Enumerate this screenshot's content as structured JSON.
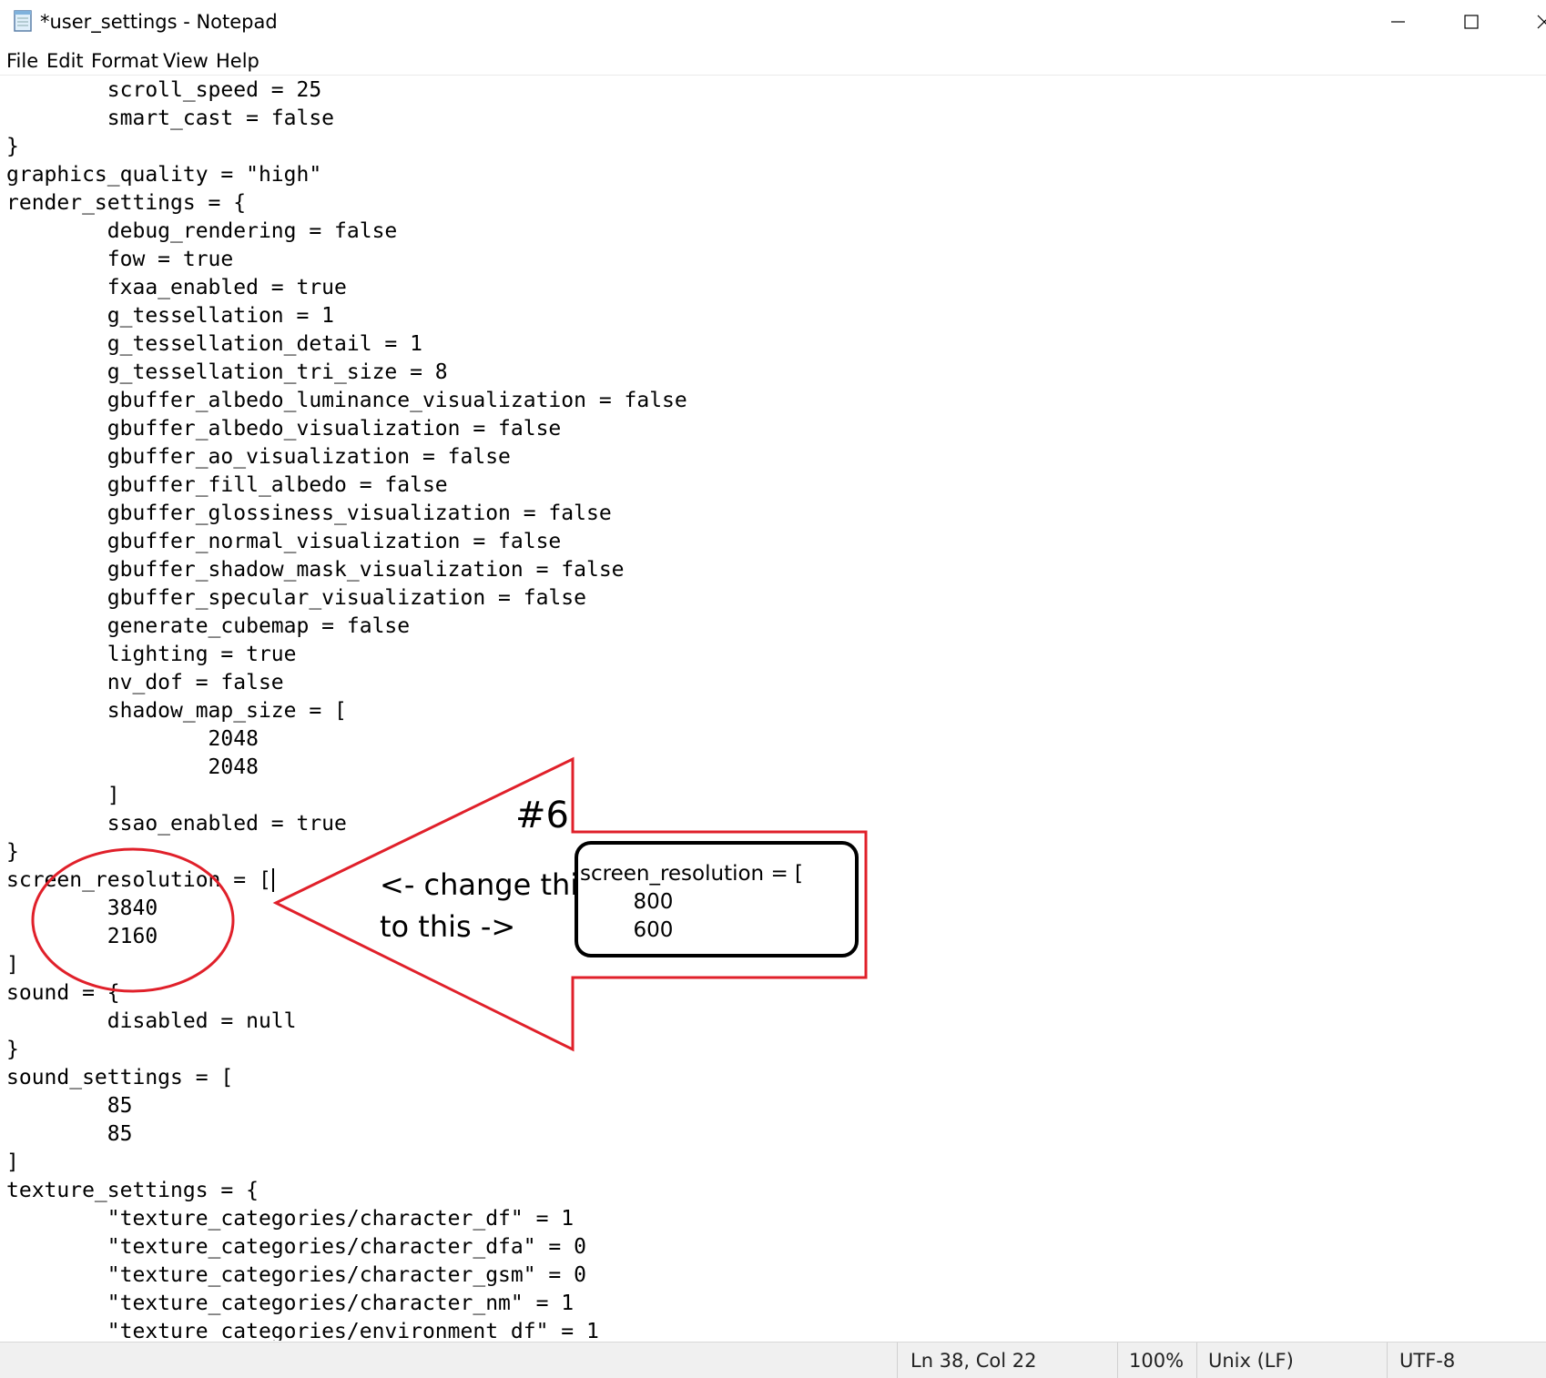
{
  "window": {
    "title": "*user_settings - Notepad",
    "app": "Notepad",
    "icon": "notepad-icon"
  },
  "menu": [
    "File",
    "Edit",
    "Format",
    "View",
    "Help"
  ],
  "editor": {
    "lines": [
      "        scroll_speed = 25",
      "        smart_cast = false",
      "}",
      "graphics_quality = \"high\"",
      "render_settings = {",
      "        debug_rendering = false",
      "        fow = true",
      "        fxaa_enabled = true",
      "        g_tessellation = 1",
      "        g_tessellation_detail = 1",
      "        g_tessellation_tri_size = 8",
      "        gbuffer_albedo_luminance_visualization = false",
      "        gbuffer_albedo_visualization = false",
      "        gbuffer_ao_visualization = false",
      "        gbuffer_fill_albedo = false",
      "        gbuffer_glossiness_visualization = false",
      "        gbuffer_normal_visualization = false",
      "        gbuffer_shadow_mask_visualization = false",
      "        gbuffer_specular_visualization = false",
      "        generate_cubemap = false",
      "        lighting = true",
      "        nv_dof = false",
      "        shadow_map_size = [",
      "                2048",
      "                2048",
      "        ]",
      "        ssao_enabled = true",
      "}",
      "screen_resolution = [",
      "        3840",
      "        2160",
      "]",
      "sound = {",
      "        disabled = null",
      "}",
      "sound_settings = [",
      "        85",
      "        85",
      "]",
      "texture_settings = {",
      "        \"texture_categories/character_df\" = 1",
      "        \"texture_categories/character_dfa\" = 0",
      "        \"texture_categories/character_gsm\" = 0",
      "        \"texture_categories/character_nm\" = 1",
      "        \"texture_categories/environment_df\" = 1"
    ]
  },
  "annotation": {
    "step": "#6",
    "line1": "<- change this",
    "line2": "to this ->",
    "replacement_lines": [
      "screen_resolution = [",
      "        800",
      "        600"
    ],
    "color": "#e0202a"
  },
  "status": {
    "position": "Ln 38, Col 22",
    "zoom": "100%",
    "line_ending": "Unix (LF)",
    "encoding": "UTF-8"
  }
}
